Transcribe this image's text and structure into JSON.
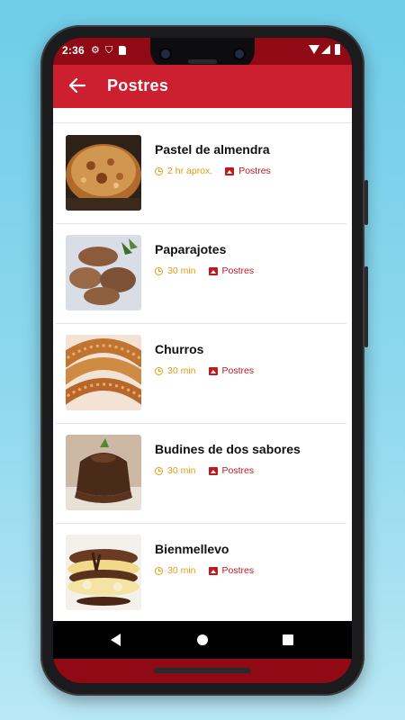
{
  "status": {
    "time": "2:36",
    "left_icons": [
      "gear-icon",
      "shield-icon",
      "sd-card-icon"
    ],
    "right_icons": [
      "wifi-icon",
      "signal-icon",
      "battery-icon"
    ]
  },
  "appbar": {
    "title": "Postres",
    "back_icon": "arrow-left-icon"
  },
  "recipes": [
    {
      "name": "Pastel de almendra",
      "time": "2 hr aprox.",
      "category": "Postres"
    },
    {
      "name": "Paparajotes",
      "time": "30 min",
      "category": "Postres"
    },
    {
      "name": "Churros",
      "time": "30 min",
      "category": "Postres"
    },
    {
      "name": "Budines de dos sabores",
      "time": "30 min",
      "category": "Postres"
    },
    {
      "name": "Bienmellevo",
      "time": "30 min",
      "category": "Postres"
    }
  ],
  "colors": {
    "appbar": "#cc1f2f",
    "statusbar": "#8f0a14",
    "time_accent": "#e49b0f",
    "category_accent": "#c0181f"
  },
  "navbar": {
    "icons": [
      "nav-back-icon",
      "nav-home-icon",
      "nav-recents-icon"
    ]
  }
}
